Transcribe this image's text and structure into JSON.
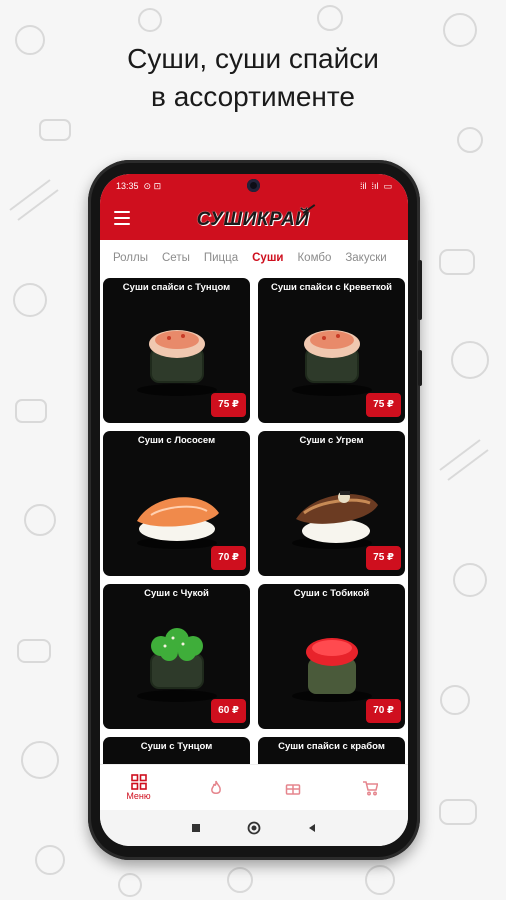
{
  "headline": {
    "line1": "Суши, суши спайси",
    "line2": "в ассортименте"
  },
  "status": {
    "time": "13:35",
    "icons_left": "⊙ ⊡",
    "signal": "⁞il",
    "net": "⁞ıl",
    "battery": "▭"
  },
  "app": {
    "logo": "СУШИКРАЙ",
    "brand_color": "#cf0f1e"
  },
  "tabs": [
    {
      "label": "Роллы",
      "active": false
    },
    {
      "label": "Сеты",
      "active": false
    },
    {
      "label": "Пицца",
      "active": false
    },
    {
      "label": "Суши",
      "active": true
    },
    {
      "label": "Комбо",
      "active": false
    },
    {
      "label": "Закуски",
      "active": false
    }
  ],
  "products": [
    {
      "title": "Суши спайси с Тунцом",
      "price": "75 ₽",
      "kind": "spicy-tuna"
    },
    {
      "title": "Суши спайси с Креветкой",
      "price": "75 ₽",
      "kind": "spicy-shrimp"
    },
    {
      "title": "Суши с Лососем",
      "price": "70 ₽",
      "kind": "salmon"
    },
    {
      "title": "Суши с Угрем",
      "price": "75 ₽",
      "kind": "eel"
    },
    {
      "title": "Суши с Чукой",
      "price": "60 ₽",
      "kind": "chuka"
    },
    {
      "title": "Суши с Тобикой",
      "price": "70 ₽",
      "kind": "tobiko"
    },
    {
      "title": "Суши с Тунцом",
      "price": "",
      "kind": "tuna"
    },
    {
      "title": "Суши спайси с крабом",
      "price": "",
      "kind": "spicy-crab"
    }
  ],
  "bottom_nav": [
    {
      "label": "Меню",
      "icon": "grid-icon"
    },
    {
      "label": "",
      "icon": "fire-icon"
    },
    {
      "label": "",
      "icon": "gift-icon"
    },
    {
      "label": "",
      "icon": "cart-icon"
    }
  ],
  "system_nav": [
    "square-icon",
    "circle-icon",
    "back-triangle-icon"
  ]
}
